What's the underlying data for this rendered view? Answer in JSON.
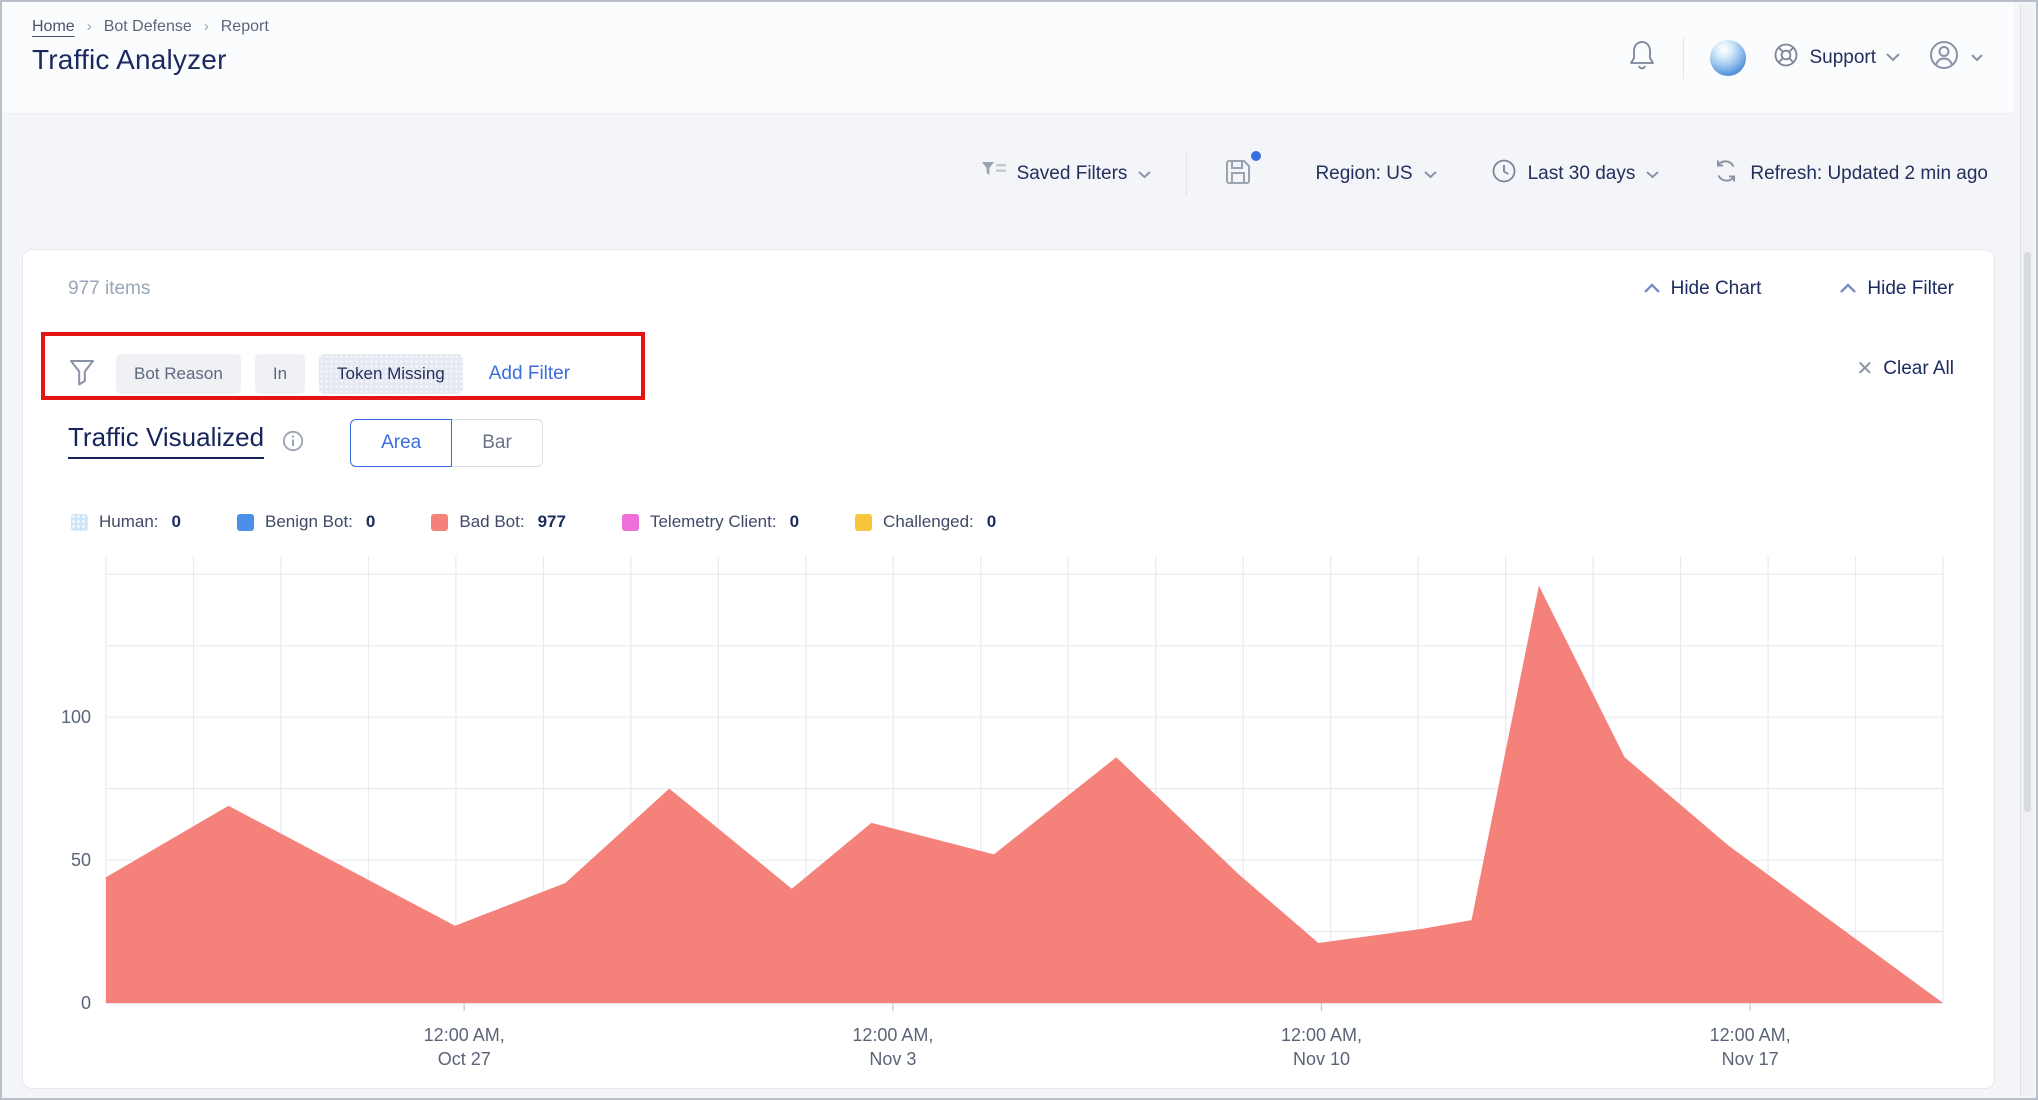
{
  "header": {
    "breadcrumb": [
      "Home",
      "Bot Defense",
      "Report"
    ],
    "title": "Traffic Analyzer",
    "support_label": "Support"
  },
  "toolbar": {
    "saved_filters": "Saved Filters",
    "region": "Region: US",
    "time_range": "Last 30 days",
    "refresh": "Refresh: Updated 2 min ago"
  },
  "panel": {
    "items_count": "977 items",
    "hide_chart": "Hide Chart",
    "hide_filter": "Hide Filter",
    "filter": {
      "field": "Bot Reason",
      "operator": "In",
      "value": "Token Missing",
      "add_filter": "Add Filter",
      "clear_all": "Clear All"
    },
    "section": {
      "title": "Traffic Visualized",
      "view_options": [
        "Area",
        "Bar"
      ],
      "selected_view": "Area"
    }
  },
  "chart_data": {
    "type": "area",
    "title": "Traffic Visualized",
    "legend_position": "top",
    "grid": true,
    "legend": [
      {
        "label": "Human:",
        "value": "0",
        "color": "#cfe4f7",
        "patterned": true
      },
      {
        "label": "Benign Bot:",
        "value": "0",
        "color": "#4a90e8",
        "patterned": false
      },
      {
        "label": "Bad Bot:",
        "value": "977",
        "color": "#f5817b",
        "patterned": false
      },
      {
        "label": "Telemetry Client:",
        "value": "0",
        "color": "#ee6fd9",
        "patterned": false
      },
      {
        "label": "Challenged:",
        "value": "0",
        "color": "#f8c63d",
        "patterned": false
      }
    ],
    "y_axis": {
      "min": 0,
      "max": 155,
      "gridline_step": 25,
      "labels": [
        0,
        50,
        100
      ]
    },
    "x_axis": {
      "unit": "days",
      "range_days": 30,
      "vertical_gridline_count": 21,
      "ticks": [
        {
          "day": 5.85,
          "lines": [
            "12:00 AM,",
            "Oct 27"
          ]
        },
        {
          "day": 12.85,
          "lines": [
            "12:00 AM,",
            "Nov 3"
          ]
        },
        {
          "day": 19.85,
          "lines": [
            "12:00 AM,",
            "Nov 10"
          ]
        },
        {
          "day": 26.85,
          "lines": [
            "12:00 AM,",
            "Nov 17"
          ]
        }
      ]
    },
    "series": [
      {
        "name": "Bad Bot",
        "total": 977,
        "color": "#f5817b",
        "points": [
          [
            0,
            44
          ],
          [
            2,
            69
          ],
          [
            5.7,
            27
          ],
          [
            7.5,
            42
          ],
          [
            9.2,
            75
          ],
          [
            11.2,
            40
          ],
          [
            12.5,
            63
          ],
          [
            14.5,
            52
          ],
          [
            16.5,
            86
          ],
          [
            18.5,
            45
          ],
          [
            19.8,
            21
          ],
          [
            21.5,
            26
          ],
          [
            22.3,
            29
          ],
          [
            23.4,
            146
          ],
          [
            24.8,
            86
          ],
          [
            26.5,
            55
          ],
          [
            30,
            0
          ]
        ]
      }
    ],
    "colors": {
      "accent_blue": "#3a6ee0",
      "annotation_red": "#e51414",
      "gridline": "#e9ebf1",
      "axis_text": "#5a6478"
    }
  }
}
